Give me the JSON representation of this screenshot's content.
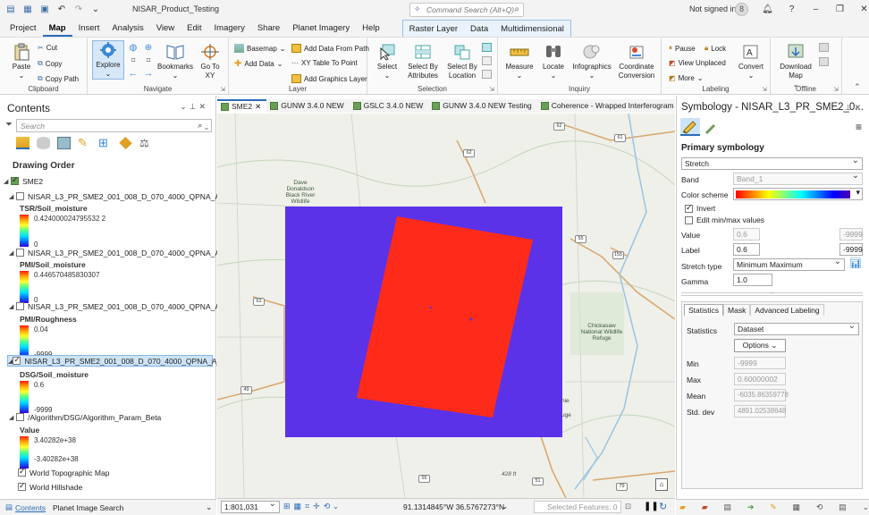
{
  "app": {
    "title": "NISAR_Product_Testing",
    "search_placeholder": "Command Search (Alt+Q)",
    "signed_in": "Not signed in",
    "avatar_initial": "8"
  },
  "tabs": [
    "Project",
    "Map",
    "Insert",
    "Analysis",
    "View",
    "Edit",
    "Imagery",
    "Share",
    "Planet Imagery",
    "Help"
  ],
  "context_tabs": [
    "Raster Layer",
    "Data",
    "Multidimensional"
  ],
  "ribbon": {
    "clipboard": {
      "label": "Clipboard",
      "paste": "Paste",
      "cut": "Cut",
      "copy": "Copy",
      "copy_path": "Copy Path"
    },
    "navigate": {
      "label": "Navigate",
      "explore": "Explore",
      "bookmarks": "Bookmarks",
      "goto": "Go To XY"
    },
    "layer": {
      "label": "Layer",
      "basemap": "Basemap",
      "add_data": "Add Data",
      "add_from_path": "Add Data From Path",
      "xy_table": "XY Table To Point",
      "add_graphics": "Add Graphics Layer"
    },
    "selection": {
      "label": "Selection",
      "select": "Select",
      "by_attr": "Select By Attributes",
      "by_loc": "Select By Location"
    },
    "inquiry": {
      "label": "Inquiry",
      "measure": "Measure",
      "locate": "Locate",
      "infographics": "Infographics",
      "coord": "Coordinate Conversion"
    },
    "labeling": {
      "label": "Labeling",
      "pause": "Pause",
      "lock": "Lock",
      "view_unplaced": "View Unplaced",
      "more": "More",
      "convert": "Convert"
    },
    "offline": {
      "label": "Offline",
      "download": "Download Map"
    }
  },
  "contents": {
    "title": "Contents",
    "search_placeholder": "Search",
    "drawing_order": "Drawing Order",
    "group": "SME2",
    "layers": [
      {
        "name": "NISAR_L3_PR_SME2_001_008_D_070_4000_QPNA_A_201908...",
        "field": "TSR/Soil_moisture",
        "max": "0.424000024795532 2",
        "min": "0"
      },
      {
        "name": "NISAR_L3_PR_SME2_001_008_D_070_4000_QPNA_A_201908...",
        "field": "PMI/Soil_moisture",
        "max": "0.446570485830307",
        "min": "0"
      },
      {
        "name": "NISAR_L3_PR_SME2_001_008_D_070_4000_QPNA_A_201908...",
        "field": "PMI/Roughness",
        "max": "0.04",
        "min": "-9999"
      },
      {
        "name": "NISAR_L3_PR_SME2_001_008_D_070_4000_QPNA_A_201908...",
        "field": "DSG/Soil_moisture",
        "max": "0.6",
        "min": "-9999"
      },
      {
        "name": "/Algorithm/DSG/Algorithm_Param_Beta",
        "field": "Value",
        "max": "3.40282e+38",
        "min": "-3.40282e+38"
      }
    ],
    "basemaps": [
      "World Topographic Map",
      "World Hillshade"
    ],
    "bottom_tabs": [
      "Contents",
      "Planet Image Search"
    ]
  },
  "map_tabs": [
    "SME2",
    "GUNW 3.4.0 NEW",
    "GSLC 3.4.0 NEW",
    "GUNW 3.4.0 NEW Testing",
    "Coherence - Wrapped Interferogram"
  ],
  "map": {
    "labels": {
      "wildlife": "Dave Donaldson Black River Wildlife",
      "chickasaw": "Chickasaw National Wildlife Refuge",
      "hie": "hie",
      "uge": "uge",
      "elev": "428 ft"
    },
    "routes": [
      "62",
      "61",
      "62",
      "55",
      "155",
      "63",
      "49",
      "55",
      "51",
      "79"
    ],
    "scale": "1:801,031",
    "coords": "91.1314845°W 36.5767273°N",
    "selected": "Selected Features: 0"
  },
  "symbology": {
    "title": "Symbology - NISAR_L3_PR_SME2_0...",
    "primary": "Primary symbology",
    "renderer": "Stretch",
    "band_label": "Band",
    "band": "Band_1",
    "color_scheme_label": "Color scheme",
    "invert": "Invert",
    "edit_minmax": "Edit min/max values",
    "value_label": "Value",
    "value_hi": "0.6",
    "value_lo": "-9999",
    "label_label": "Label",
    "label_hi": "0.6",
    "label_lo": "-9999",
    "stretch_type_label": "Stretch type",
    "stretch_type": "Minimum Maximum",
    "gamma_label": "Gamma",
    "gamma": "1.0",
    "tabs": [
      "Statistics",
      "Mask",
      "Advanced Labeling"
    ],
    "stats_label": "Statistics",
    "stats_source": "Dataset",
    "options": "Options",
    "min_label": "Min",
    "min": "-9999",
    "max_label": "Max",
    "max": "0.60000002",
    "mean_label": "Mean",
    "mean": "-6035.86359778",
    "std_label": "Std. dev",
    "std": "4891.02538648"
  }
}
